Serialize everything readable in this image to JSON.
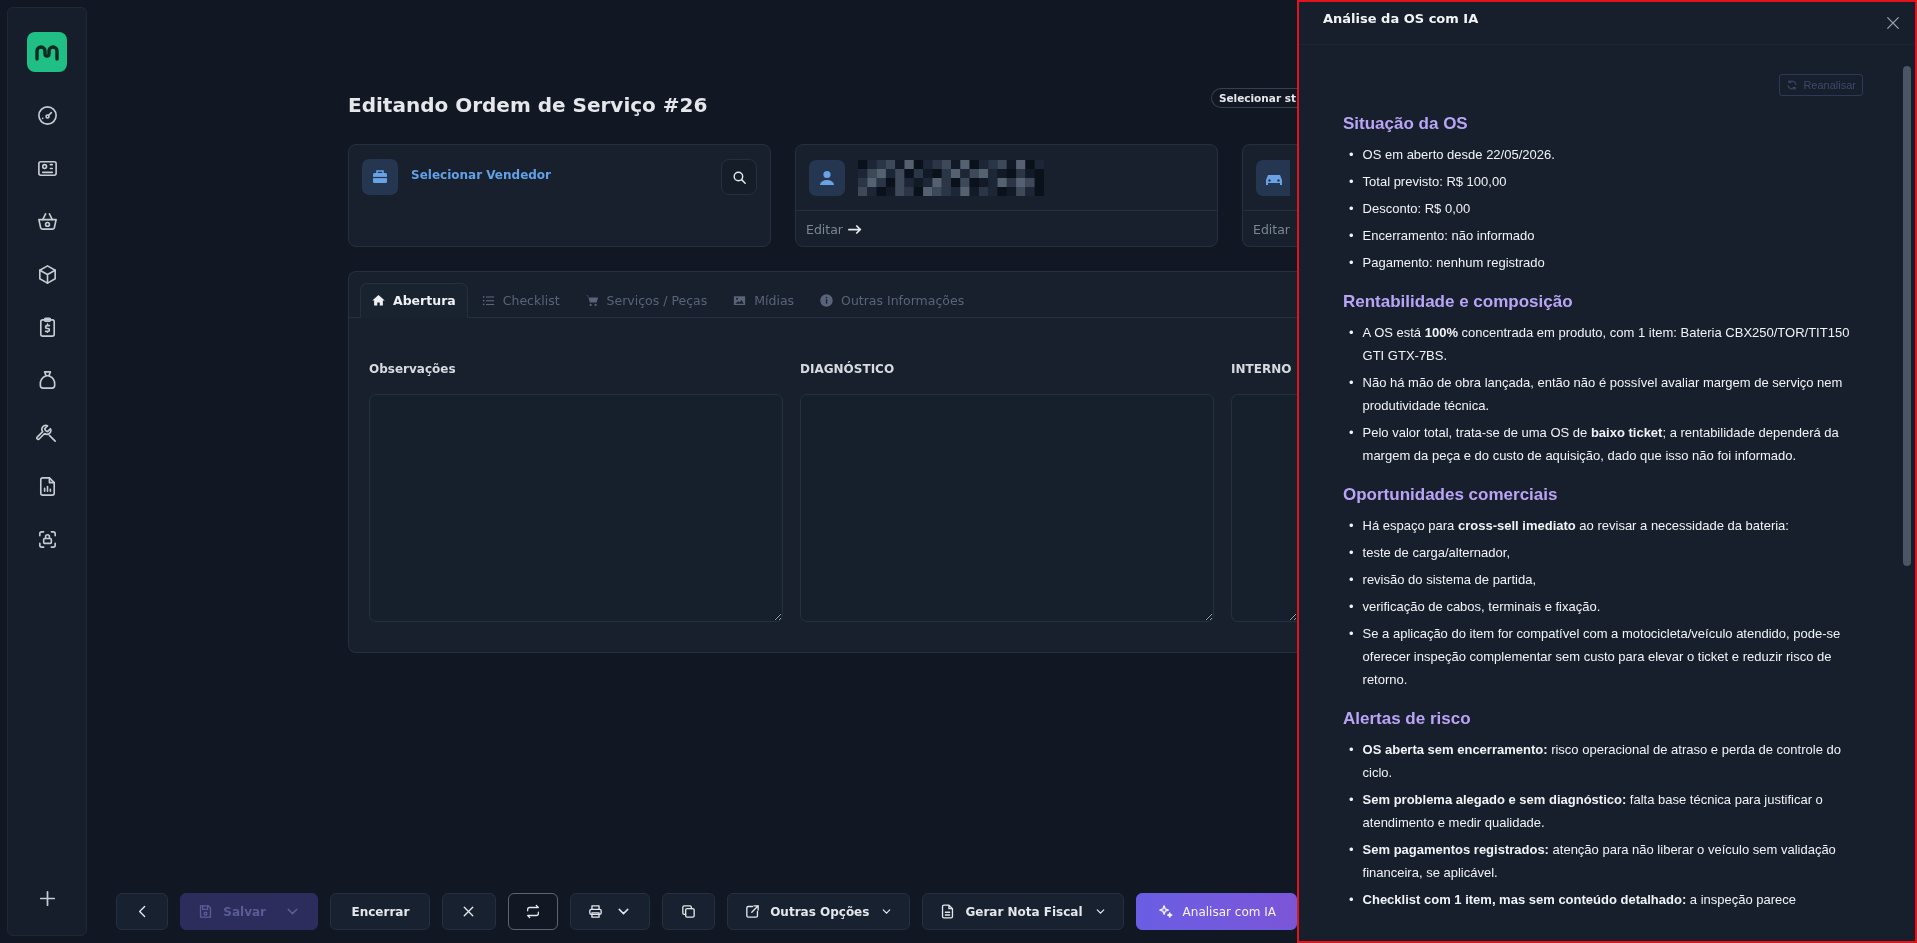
{
  "page": {
    "title": "Editando Ordem de Serviço #26",
    "status_pill": "Selecionar st"
  },
  "cards": [
    {
      "kind": "seller",
      "label": "Selecionar Vendedor"
    },
    {
      "kind": "customer",
      "link": "Editar"
    },
    {
      "kind": "vehicle",
      "link": "Editar"
    }
  ],
  "tabs": [
    {
      "kind": "home",
      "label": "Abertura",
      "selected": true
    },
    {
      "kind": "list",
      "label": "Checklist",
      "selected": false
    },
    {
      "kind": "cart",
      "label": "Serviços / Peças",
      "selected": false
    },
    {
      "kind": "image",
      "label": "Mídias",
      "selected": false
    },
    {
      "kind": "info",
      "label": "Outras Informações",
      "selected": false
    }
  ],
  "fields": [
    {
      "label": "Observações"
    },
    {
      "label": "DIAGNÓSTICO"
    },
    {
      "label": "INTERNO"
    }
  ],
  "toolbar": [
    {
      "kind": "back",
      "disabled": false
    },
    {
      "kind": "save",
      "label": "Salvar",
      "disabled": true
    },
    {
      "kind": "text",
      "label": "Encerrar",
      "disabled": false
    },
    {
      "kind": "close",
      "disabled": false
    },
    {
      "kind": "repeat",
      "disabled": false
    },
    {
      "kind": "print",
      "disabled": false
    },
    {
      "kind": "copy",
      "disabled": false
    },
    {
      "kind": "link-menu",
      "label": "Outras Opções",
      "disabled": false
    },
    {
      "kind": "doc-menu",
      "label": "Gerar Nota Fiscal",
      "disabled": false
    },
    {
      "kind": "ai",
      "label": "Analisar com IA",
      "disabled": false
    }
  ],
  "panel": {
    "title": "Análise da OS com IA",
    "bullet": "•",
    "reanalyze": {
      "label": "Reanalisar",
      "disabled": true
    },
    "sections": [
      {
        "heading": "Situação da OS",
        "items": [
          "OS em aberto desde 22/05/2026.",
          "Total previsto: R$ 100,00",
          "Desconto: R$ 0,00",
          "Encerramento: não informado",
          "Pagamento: nenhum registrado"
        ]
      },
      {
        "heading": "Rentabilidade e composição",
        "items": [
          "A OS está **100%** concentrada em produto, com 1 item: Bateria CBX250/TOR/TIT150 GTI GTX-7BS.",
          "Não há mão de obra lançada, então não é possível avaliar margem de serviço nem produtividade técnica.",
          "Pelo valor total, trata-se de uma OS de **baixo ticket**; a rentabilidade dependerá da margem da peça e do custo de aquisição, dado que isso não foi informado."
        ]
      },
      {
        "heading": "Oportunidades comerciais",
        "items": [
          "Há espaço para **cross-sell imediato** ao revisar a necessidade da bateria:",
          "teste de carga/alternador,",
          "revisão do sistema de partida,",
          "verificação de cabos, terminais e fixação.",
          "Se a aplicação do item for compatível com a motocicleta/veículo atendido, pode-se oferecer inspeção complementar sem custo para elevar o ticket e reduzir risco de retorno."
        ]
      },
      {
        "heading": "Alertas de risco",
        "items": [
          "**OS aberta sem encerramento:** risco operacional de atraso e perda de controle do ciclo.",
          "**Sem problema alegado e sem diagnóstico:** falta base técnica para justificar o atendimento e medir qualidade.",
          "**Sem pagamentos registrados:** atenção para não liberar o veículo sem validação financeira, se aplicável.",
          "**Checklist com 1 item, mas sem conteúdo detalhado:** a inspeção parece"
        ]
      }
    ]
  }
}
